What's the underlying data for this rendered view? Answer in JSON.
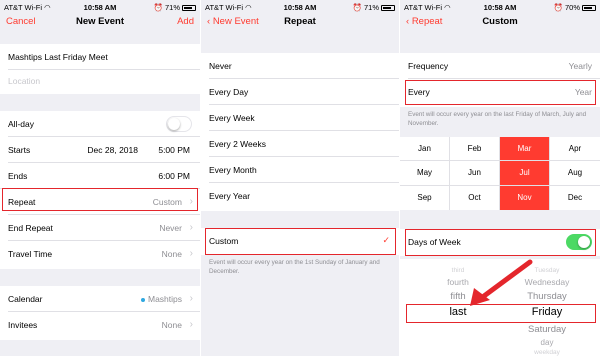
{
  "status": {
    "carrier": "AT&T Wi-Fi",
    "time": "10:58 AM",
    "battery1": "71%",
    "battery2": "71%",
    "battery3": "70%"
  },
  "screen1": {
    "nav": {
      "cancel": "Cancel",
      "title": "New Event",
      "add": "Add"
    },
    "event_title": "Mashtips Last Friday Meet",
    "location_placeholder": "Location",
    "rows": {
      "allday": "All-day",
      "starts": "Starts",
      "starts_date": "Dec 28, 2018",
      "starts_time": "5:00 PM",
      "ends": "Ends",
      "ends_time": "6:00 PM",
      "repeat": "Repeat",
      "repeat_val": "Custom",
      "end_repeat": "End Repeat",
      "end_repeat_val": "Never",
      "travel": "Travel Time",
      "travel_val": "None",
      "calendar": "Calendar",
      "calendar_val": "Mashtips",
      "invitees": "Invitees",
      "invitees_val": "None"
    }
  },
  "screen2": {
    "nav": {
      "back": "New Event",
      "title": "Repeat"
    },
    "options": [
      "Never",
      "Every Day",
      "Every Week",
      "Every 2 Weeks",
      "Every Month",
      "Every Year"
    ],
    "custom": "Custom",
    "note": "Event will occur every year on the 1st Sunday of January and December."
  },
  "screen3": {
    "nav": {
      "back": "Repeat",
      "title": "Custom"
    },
    "frequency": "Frequency",
    "frequency_val": "Yearly",
    "every": "Every",
    "every_val": "Year",
    "note": "Event will occur every year on the last Friday of March, July and November.",
    "months": [
      "Jan",
      "Feb",
      "Mar",
      "Apr",
      "May",
      "Jun",
      "Jul",
      "Aug",
      "Sep",
      "Oct",
      "Nov",
      "Dec"
    ],
    "days_of_week": "Days of Week",
    "picker_col1": [
      "third",
      "fourth",
      "fifth",
      "last"
    ],
    "picker_col2": [
      "Tuesday",
      "Wednesday",
      "Thursday",
      "Friday",
      "Saturday",
      "day",
      "weekday"
    ]
  },
  "colors": {
    "accent": "#ff3b30",
    "annotation": "#e4262c",
    "toggle_on": "#4cd964"
  }
}
